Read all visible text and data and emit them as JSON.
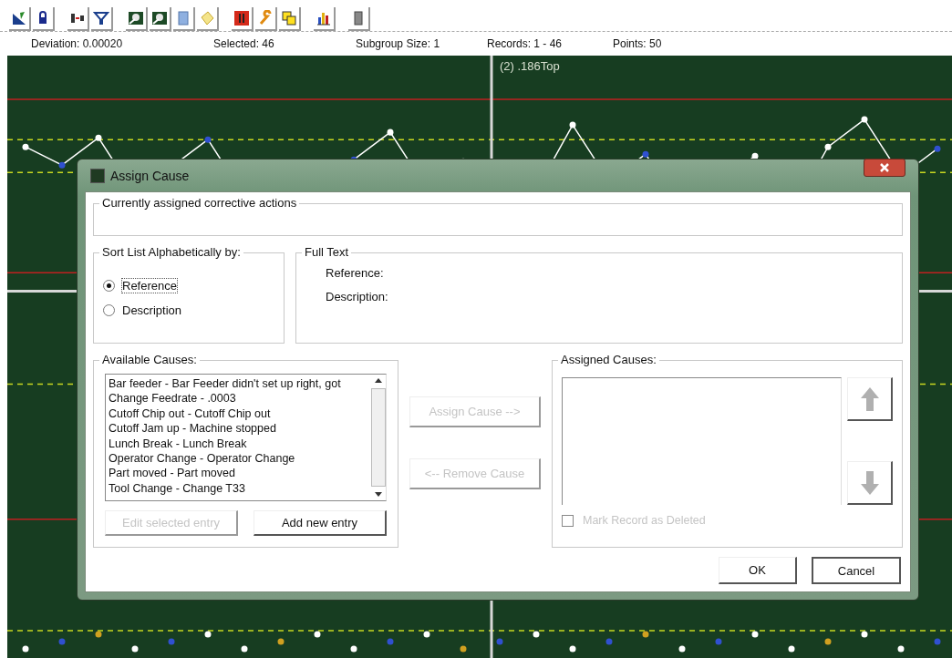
{
  "status_bar": [
    "Deviation: 0.00020",
    "Selected: 46",
    "Subgroup Size: 1",
    "Records: 1 - 46",
    "Points: 50"
  ],
  "chart": {
    "label": "(2) .186Top"
  },
  "dialog": {
    "title": "Assign Cause",
    "corrective": {
      "label": "Currently assigned corrective actions"
    },
    "sort": {
      "label": "Sort List Alphabetically by:",
      "options": [
        {
          "label": "Reference",
          "selected": true
        },
        {
          "label": "Description",
          "selected": false
        }
      ]
    },
    "full_text": {
      "label": "Full Text",
      "fields": [
        "Reference:",
        "Description:"
      ]
    },
    "available": {
      "label": "Available Causes:",
      "items": [
        "Bar feeder - Bar Feeder didn't set up right, got",
        "Change Feedrate - .0003",
        "Cutoff Chip out - Cutoff Chip out",
        "Cutoff Jam up - Machine stopped",
        "Lunch Break - Lunch Break",
        "Operator Change - Operator Change",
        "Part moved - Part moved",
        "Tool Change - Change T33"
      ],
      "buttons": [
        {
          "label": "Edit selected entry",
          "disabled": true
        },
        {
          "label": "Add new entry",
          "disabled": false
        }
      ]
    },
    "transfer": [
      {
        "label": "Assign Cause -->",
        "disabled": true
      },
      {
        "label": "<-- Remove Cause",
        "disabled": true
      }
    ],
    "assigned": {
      "label": "Assigned Causes:",
      "move_disabled": true,
      "mark_deleted": {
        "label": "Mark Record as Deleted",
        "checked": false,
        "disabled": true
      }
    },
    "buttons": [
      {
        "label": "OK",
        "default": false
      },
      {
        "label": "Cancel",
        "default": true
      }
    ]
  }
}
